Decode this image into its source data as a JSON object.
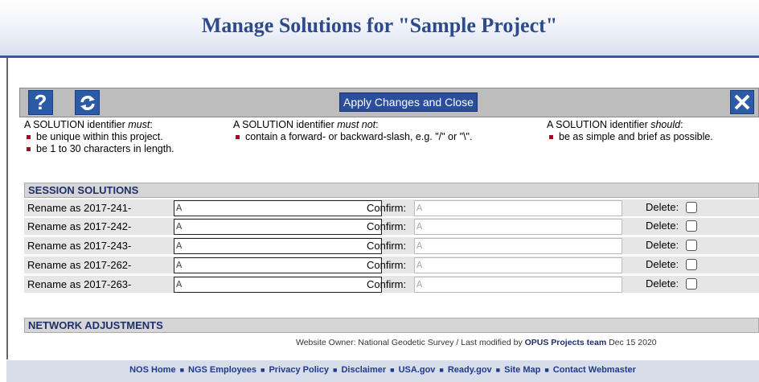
{
  "page": {
    "title": "Manage Solutions for \"Sample Project\""
  },
  "toolbar": {
    "help_label": "?",
    "apply_label": "Apply Changes and Close"
  },
  "rules": {
    "must": {
      "head_prefix": "A SOLUTION identifier ",
      "head_em": "must",
      "items": [
        "be unique within this project.",
        "be 1 to 30 characters in length."
      ]
    },
    "must_not": {
      "head_prefix": "A SOLUTION identifier ",
      "head_em": "must not",
      "items": [
        "contain a forward- or backward-slash, e.g. \"/\" or \"\\\"."
      ]
    },
    "should": {
      "head_prefix": "A SOLUTION identifier ",
      "head_em": "should",
      "items": [
        "be as simple and brief as possible."
      ]
    }
  },
  "sections": {
    "session": "SESSION SOLUTIONS",
    "network": "NETWORK ADJUSTMENTS"
  },
  "solutions": {
    "confirm_label": "Confirm:",
    "delete_label": "Delete:",
    "rows": [
      {
        "label": "Rename as 2017-241-",
        "value": "A",
        "confirm": "A"
      },
      {
        "label": "Rename as 2017-242-",
        "value": "A",
        "confirm": "A"
      },
      {
        "label": "Rename as 2017-243-",
        "value": "A",
        "confirm": "A"
      },
      {
        "label": "Rename as 2017-262-",
        "value": "A",
        "confirm": "A"
      },
      {
        "label": "Rename as 2017-263-",
        "value": "A",
        "confirm": "A"
      }
    ]
  },
  "owner": {
    "text": "Website Owner: National Geodetic Survey  /  Last modified by ",
    "link": "OPUS Projects team",
    "date": " Dec 15 2020"
  },
  "footer": {
    "links": [
      "NOS Home",
      "NGS Employees",
      "Privacy Policy",
      "Disclaimer",
      "USA.gov",
      "Ready.gov",
      "Site Map",
      "Contact Webmaster"
    ]
  }
}
